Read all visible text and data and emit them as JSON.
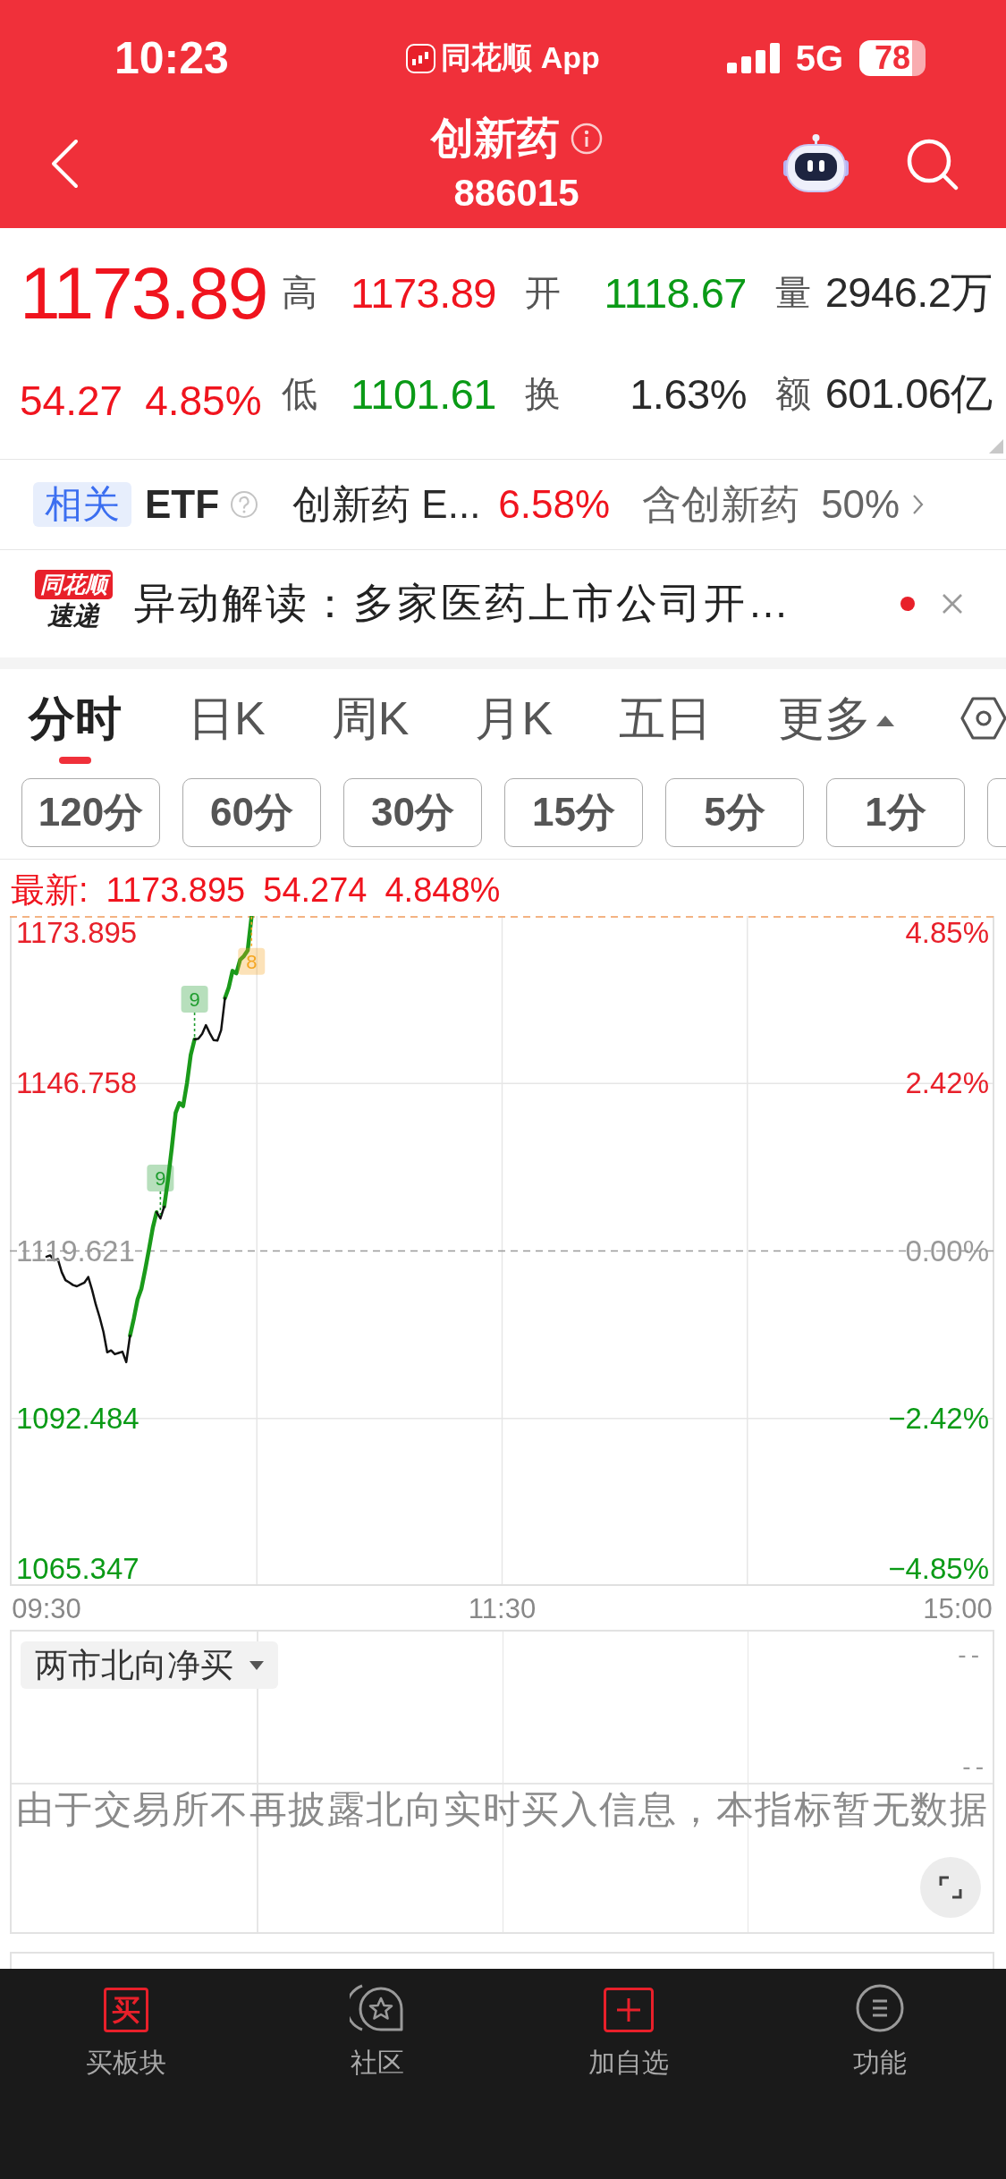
{
  "status_bar": {
    "time": "10:23",
    "app_label": "同花顺 App",
    "network": "5G",
    "battery": "78"
  },
  "nav_bar": {
    "title": "创新药",
    "code": "886015"
  },
  "quote": {
    "price": "1173.89",
    "change": "54.27",
    "change_pct": "4.85%",
    "rising": true,
    "stats": [
      {
        "label": "高",
        "value": "1173.89",
        "color": "#f0141e"
      },
      {
        "label": "开",
        "value": "1118.67",
        "color": "#0a9a16"
      },
      {
        "label": "量",
        "value": "2946.2万",
        "color": "#2a2a2a"
      },
      {
        "label": "低",
        "value": "1101.61",
        "color": "#0a9a16"
      },
      {
        "label": "换",
        "value": "1.63%",
        "color": "#2a2a2a"
      },
      {
        "label": "额",
        "value": "601.06亿",
        "color": "#2a2a2a"
      }
    ]
  },
  "etf_bar": {
    "tag": "相关",
    "title": "ETF",
    "fund_name": "创新药 E...",
    "fund_change": "6.58%",
    "fund_rising": true,
    "holding_label": "含创新药",
    "holding_share": "50%"
  },
  "news": {
    "source_logo": [
      "同花顺",
      "速递"
    ],
    "headline": "异动解读：多家医药上市公司开…",
    "unread": true
  },
  "period_tabs": [
    {
      "label": "分时",
      "selected": true,
      "kind": "tab"
    },
    {
      "label": "日K",
      "selected": false,
      "kind": "tab"
    },
    {
      "label": "周K",
      "selected": false,
      "kind": "tab"
    },
    {
      "label": "月K",
      "selected": false,
      "kind": "tab"
    },
    {
      "label": "五日",
      "selected": false,
      "kind": "tab"
    },
    {
      "label": "更多",
      "selected": false,
      "kind": "menu"
    }
  ],
  "interval_buttons": {
    "items": [
      {
        "label": "120分",
        "selected": false
      },
      {
        "label": "60分",
        "selected": false
      },
      {
        "label": "30分",
        "selected": false
      },
      {
        "label": "15分",
        "selected": false
      },
      {
        "label": "5分",
        "selected": false
      },
      {
        "label": "1分",
        "selected": false
      }
    ],
    "cut_off_more": true
  },
  "intraday_chart": {
    "latest": {
      "label": "最新:",
      "price": "1173.895",
      "change": "54.274",
      "pct": "4.848%",
      "rising": true
    },
    "right_ticks": [
      "4.85%",
      "2.42%",
      "0.00%",
      "−2.42%",
      "−4.85%"
    ],
    "markers": [
      {
        "color": "#1f9d2f"
      },
      {
        "color": "#1f9d2f"
      },
      {
        "color": "#f5a623"
      }
    ],
    "chart_data": {
      "type": "line",
      "categories": [
        "09:30",
        null,
        null,
        null,
        null,
        null,
        null,
        null,
        null,
        null,
        null,
        null,
        null,
        null,
        null,
        null,
        null,
        null,
        null,
        null,
        null,
        null,
        null,
        null,
        null,
        null,
        null,
        null,
        null,
        null,
        null,
        null,
        null,
        null,
        null,
        null,
        null,
        null,
        null,
        null,
        null,
        null,
        null,
        null,
        null,
        null,
        null,
        null,
        null,
        null,
        null,
        null,
        null,
        null,
        null,
        null,
        null,
        null,
        null,
        null,
        null,
        null,
        null,
        null,
        null,
        null,
        null,
        null,
        null,
        null,
        null,
        null,
        null,
        null,
        null,
        null,
        null,
        null,
        null,
        null,
        null,
        null,
        null,
        null,
        null,
        null,
        null,
        null,
        null,
        null,
        null,
        null,
        null,
        null,
        null,
        null,
        null,
        null,
        null,
        null,
        null,
        null,
        null,
        null,
        null,
        null,
        null,
        null,
        null,
        null,
        null,
        null,
        null,
        null,
        null,
        null,
        null,
        null,
        null,
        null,
        "11:30",
        null,
        null,
        null,
        null,
        null,
        null,
        null,
        null,
        null,
        null,
        null,
        null,
        null,
        null,
        null,
        null,
        null,
        null,
        null,
        null,
        null,
        null,
        null,
        null,
        null,
        null,
        null,
        null,
        null,
        null,
        null,
        null,
        null,
        null,
        null,
        null,
        null,
        null,
        null,
        null,
        null,
        null,
        null,
        null,
        null,
        null,
        null,
        null,
        null,
        null,
        null,
        null,
        null,
        null,
        null,
        null,
        null,
        null,
        null,
        null,
        null,
        null,
        null,
        null,
        null,
        null,
        null,
        null,
        null,
        null,
        null,
        null,
        null,
        null,
        null,
        null,
        null,
        null,
        null,
        null,
        null,
        null,
        null,
        null,
        null,
        null,
        null,
        null,
        null,
        null,
        null,
        null,
        null,
        null,
        null,
        null,
        null,
        null,
        null,
        null,
        null,
        null,
        null,
        null,
        null,
        null,
        null,
        null,
        null,
        null,
        null,
        null,
        null,
        null,
        null,
        null,
        null,
        null,
        null,
        "15:00"
      ],
      "series": [
        {
          "color": "#1a9a1a",
          "values": [
            null,
            null,
            null,
            null,
            null,
            null,
            null,
            null,
            null,
            null,
            null,
            null,
            null,
            null,
            null,
            null,
            null,
            null,
            null,
            null,
            null,
            null,
            1105.9,
            1108.7,
            1111.8,
            1113.5,
            1116.6,
            1119.9,
            1123.4,
            1125.9,
            null,
            1126.8,
            1131.2,
            1136.3,
            1142.0,
            1143.6,
            1143.1,
            1146.8,
            1151.4,
            1153.9,
            null,
            null,
            null,
            null,
            null,
            null,
            null,
            1160.6,
            1162.3,
            1165.0,
            1164.6,
            1166.8,
            1167.4,
            1168.3,
            1173.8,
            null,
            null,
            null,
            null,
            null,
            null,
            null,
            null,
            null,
            null,
            null,
            null,
            null,
            null,
            null,
            null,
            null,
            null,
            null,
            null,
            null,
            null,
            null,
            null,
            null,
            null,
            null,
            null,
            null,
            null,
            null,
            null,
            null,
            null,
            null,
            null,
            null,
            null,
            null,
            null,
            null,
            null,
            null,
            null,
            null,
            null,
            null,
            null,
            null,
            null,
            null,
            null,
            null,
            null,
            null,
            null,
            null,
            null,
            null,
            null,
            null,
            null,
            null,
            null,
            null,
            null,
            null,
            null,
            null,
            null,
            null,
            null,
            null,
            null,
            null,
            null,
            null,
            null,
            null,
            null,
            null,
            null,
            null,
            null,
            null,
            null,
            null,
            null,
            null,
            null,
            null,
            null,
            null,
            null,
            null,
            null,
            null,
            null,
            null,
            null,
            null,
            null,
            null,
            null,
            null,
            null,
            null,
            null,
            null,
            null,
            null,
            null,
            null,
            null,
            null,
            null,
            null,
            null,
            null,
            null,
            null,
            null,
            null,
            null,
            null,
            null,
            null,
            null,
            null,
            null,
            null,
            null,
            null,
            null,
            null,
            null,
            null,
            null,
            null,
            null,
            null,
            null,
            null,
            null,
            null,
            null,
            null,
            null,
            null,
            null,
            null,
            null,
            null,
            null,
            null,
            null,
            null,
            null,
            null,
            null,
            null,
            null,
            null,
            null,
            null,
            null,
            null,
            null,
            null,
            null,
            null,
            null,
            null,
            null,
            null,
            null,
            null,
            null,
            null,
            null,
            null,
            null,
            null,
            null,
            null,
            null
          ]
        },
        {
          "color": "#111111",
          "values": [
            1118.7,
            1118.9,
            1118.1,
            1118.3,
            1116.2,
            1114.9,
            1114.5,
            1114.1,
            1113.9,
            1114.2,
            1114.5,
            1115.4,
            1113.3,
            1110.9,
            1108.9,
            1106.5,
            1103.2,
            1103.5,
            1102.9,
            1103.1,
            1103.3,
            1101.6,
            1105.9,
            null,
            null,
            null,
            null,
            null,
            null,
            1125.9,
            1124.9,
            1126.8,
            null,
            null,
            null,
            null,
            null,
            null,
            null,
            1153.9,
            1154.0,
            1154.8,
            1156.2,
            1154.9,
            1153.8,
            1153.7,
            1155.4,
            1160.6,
            null,
            null,
            null,
            null,
            null,
            null,
            null,
            null,
            null,
            null,
            null,
            null,
            null,
            null,
            null,
            null,
            null,
            null,
            null,
            null,
            null,
            null,
            null,
            null,
            null,
            null,
            null,
            null,
            null,
            null,
            null,
            null,
            null,
            null,
            null,
            null,
            null,
            null,
            null,
            null,
            null,
            null,
            null,
            null,
            null,
            null,
            null,
            null,
            null,
            null,
            null,
            null,
            null,
            null,
            null,
            null,
            null,
            null,
            null,
            null,
            null,
            null,
            null,
            null,
            null,
            null,
            null,
            null,
            null,
            null,
            null,
            null,
            null,
            null,
            null,
            null,
            null,
            null,
            null,
            null,
            null,
            null,
            null,
            null,
            null,
            null,
            null,
            null,
            null,
            null,
            null,
            null,
            null,
            null,
            null,
            null,
            null,
            null,
            null,
            null,
            null,
            null,
            null,
            null,
            null,
            null,
            null,
            null,
            null,
            null,
            null,
            null,
            null,
            null,
            null,
            null,
            null,
            null,
            null,
            null,
            null,
            null,
            null,
            null,
            null,
            null,
            null,
            null,
            null,
            null,
            null,
            null,
            null,
            null,
            null,
            null,
            null,
            null,
            null,
            null,
            null,
            null,
            null,
            null,
            null,
            null,
            null,
            null,
            null,
            null,
            null,
            null,
            null,
            null,
            null,
            null,
            null,
            null,
            null,
            null,
            null,
            null,
            null,
            null,
            null,
            null,
            null,
            null,
            null,
            null,
            null,
            null,
            null,
            null,
            null,
            null,
            null,
            null,
            null,
            null,
            null,
            null,
            null,
            null,
            null,
            null,
            null,
            null,
            null,
            null,
            null,
            null,
            null
          ]
        }
      ],
      "ylim": [
        1065.347,
        1173.895
      ],
      "yticks": [
        1065.347,
        1092.484,
        1119.621,
        1146.758,
        1173.895
      ],
      "ref_lines": [
        {
          "axis": "y",
          "value": 1119.621
        }
      ],
      "annotations": [
        {
          "y": 1124.9,
          "text": "9"
        },
        {
          "y": 1153.9,
          "text": "9"
        },
        {
          "y": 1173.8,
          "text": "8"
        }
      ]
    }
  },
  "north_panel": {
    "indicator": "两市北向净买",
    "top_reading": "--",
    "bottom_reading": "--",
    "message": "由于交易所不再披露北向实时买入信息，本指标暂无数据"
  },
  "bottom_nav": [
    {
      "label": "买板块",
      "kind": "buy",
      "badge": "买"
    },
    {
      "label": "社区",
      "kind": "community"
    },
    {
      "label": "加自选",
      "kind": "add"
    },
    {
      "label": "功能",
      "kind": "menu"
    }
  ]
}
